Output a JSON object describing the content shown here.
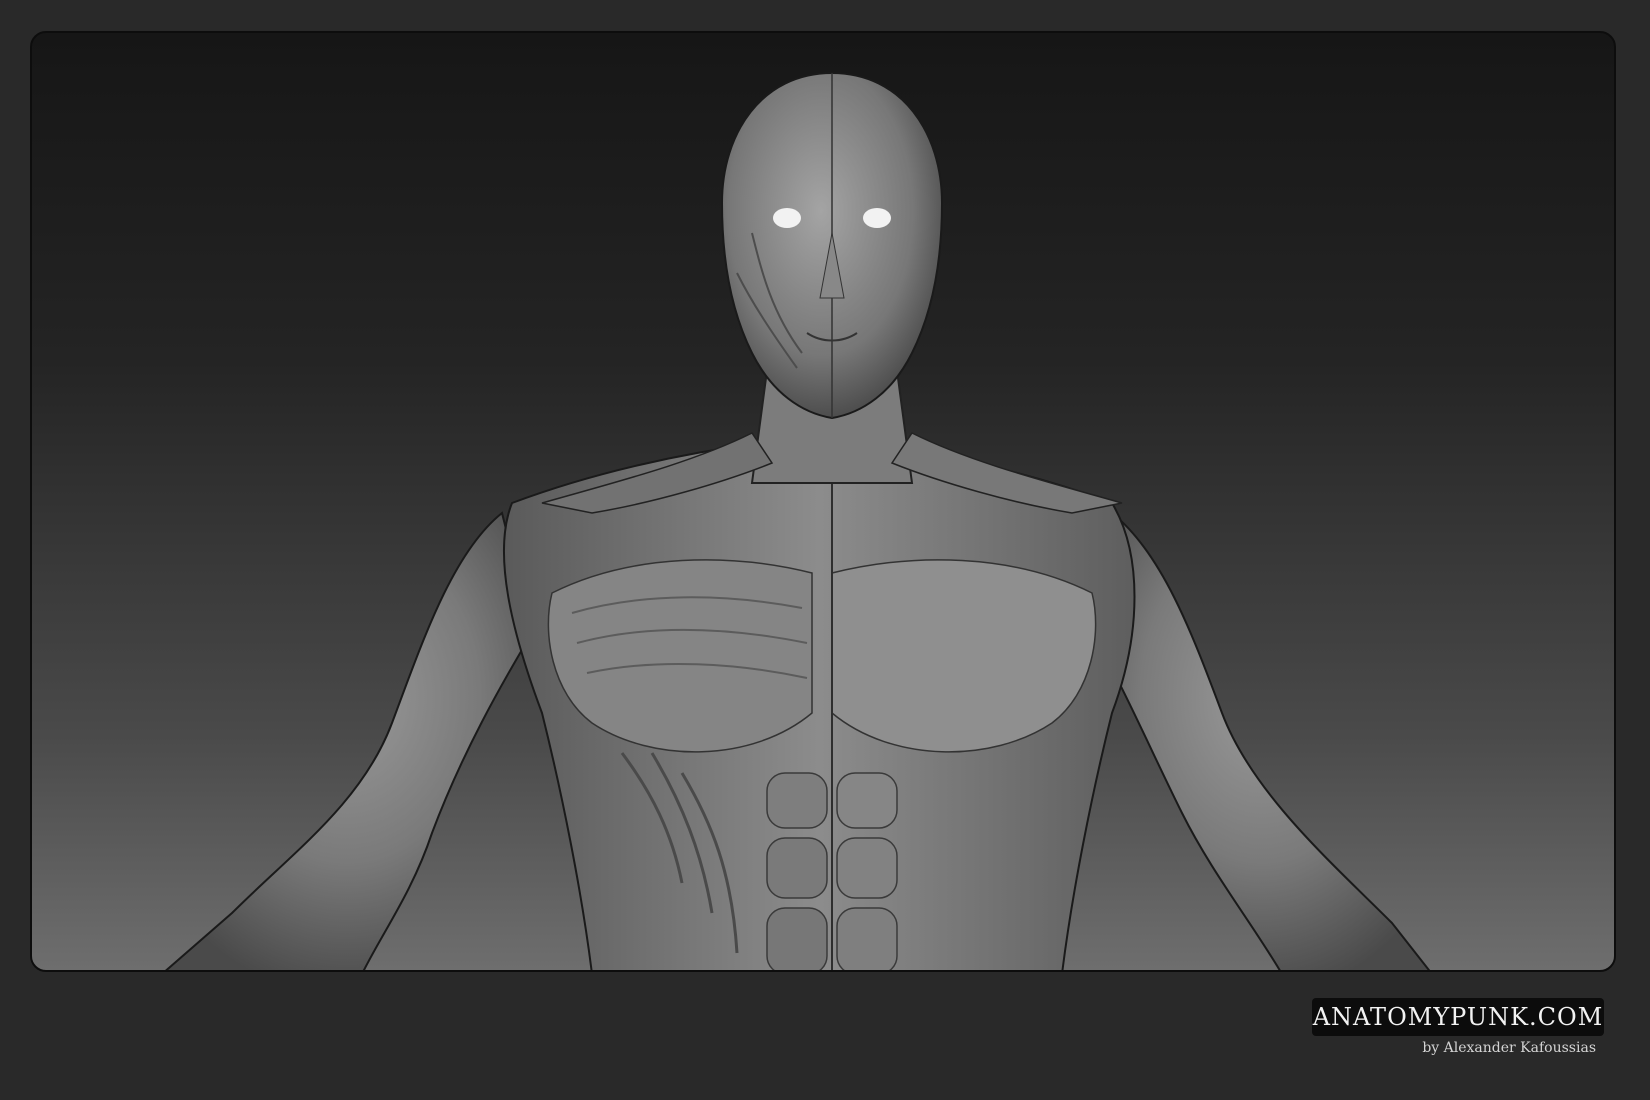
{
  "image": {
    "subject": "3D anatomy render",
    "background_color": "#292929"
  },
  "brand": {
    "label": "ANATOMYPUNK.COM"
  },
  "credit": {
    "label": "by Alexander Kafoussias"
  }
}
